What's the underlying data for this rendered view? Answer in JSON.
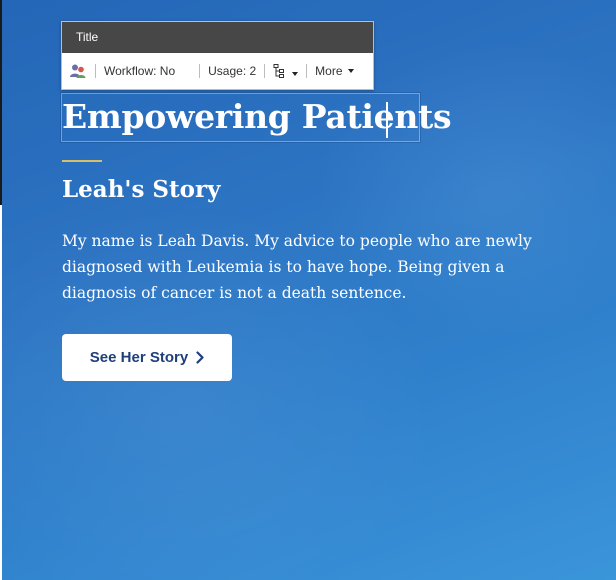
{
  "toolbar": {
    "title": "Title",
    "workflow": "Workflow: No",
    "usage": "Usage: 2",
    "more": "More",
    "icons": {
      "users": "users-icon",
      "structure": "sitemap-icon",
      "caret": "caret-down-icon"
    }
  },
  "hero": {
    "title": "Empowering Patients",
    "subtitle": "Leah's Story",
    "body": "My name is Leah Davis. My advice to people who are newly diagnosed with Leukemia is to have hope. Being given a diagnosis of cancer is not a death sentence.",
    "cta_label": "See Her Story",
    "cta_icon": "chevron-right-icon"
  },
  "colors": {
    "background": "#2c73c2",
    "accent": "#d7bf6a",
    "cta_text": "#1f3f7a",
    "toolbar_header": "#474747"
  }
}
